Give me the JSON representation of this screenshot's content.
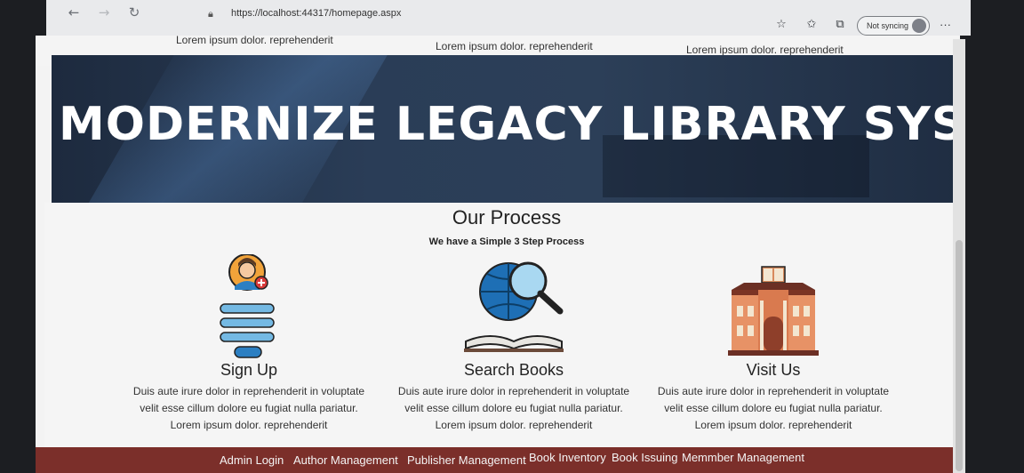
{
  "browser": {
    "url": "https://localhost:44317/homepage.aspx",
    "sync_label": "Not syncing",
    "icons": [
      "back-icon",
      "forward-icon",
      "refresh-icon",
      "lock-icon",
      "add-favorite-icon",
      "favorites-icon",
      "collections-icon",
      "profile-icon",
      "more-icon"
    ]
  },
  "top_strip": {
    "texts": [
      "Lorem ipsum dolor. reprehenderit",
      "Lorem ipsum dolor. reprehenderit",
      "Lorem ipsum dolor. reprehenderit"
    ]
  },
  "hero": {
    "title": "MODERNIZE LEGACY LIBRARY SYSTEMS"
  },
  "process": {
    "title": "Our Process",
    "subtitle": "We have a Simple 3 Step Process",
    "steps": [
      {
        "title": "Sign Up",
        "line1": "Duis aute irure dolor in reprehenderit in voluptate",
        "line2": "velit esse cillum dolore eu fugiat nulla pariatur.",
        "line3": "Lorem ipsum dolor. reprehenderit",
        "icon": "user-signup-icon"
      },
      {
        "title": "Search Books",
        "line1": "Duis aute irure dolor in reprehenderit in voluptate",
        "line2": "velit esse cillum dolore eu fugiat nulla pariatur.",
        "line3": "Lorem ipsum dolor. reprehenderit",
        "icon": "search-books-icon"
      },
      {
        "title": "Visit Us",
        "line1": "Duis aute irure dolor in reprehenderit in voluptate",
        "line2": "velit esse cillum dolore eu fugiat nulla pariatur.",
        "line3": "Lorem ipsum dolor. reprehenderit",
        "icon": "library-building-icon"
      }
    ]
  },
  "footer": {
    "links": [
      "Admin Login",
      "Author Management",
      "Publisher Management",
      "Book Inventory",
      "Book Issuing",
      "Memmber Management"
    ]
  },
  "colors": {
    "footer_bg": "#7b2f2a",
    "hero_bg": "#1d2a3e",
    "accent_blue": "#1e6fb5"
  }
}
